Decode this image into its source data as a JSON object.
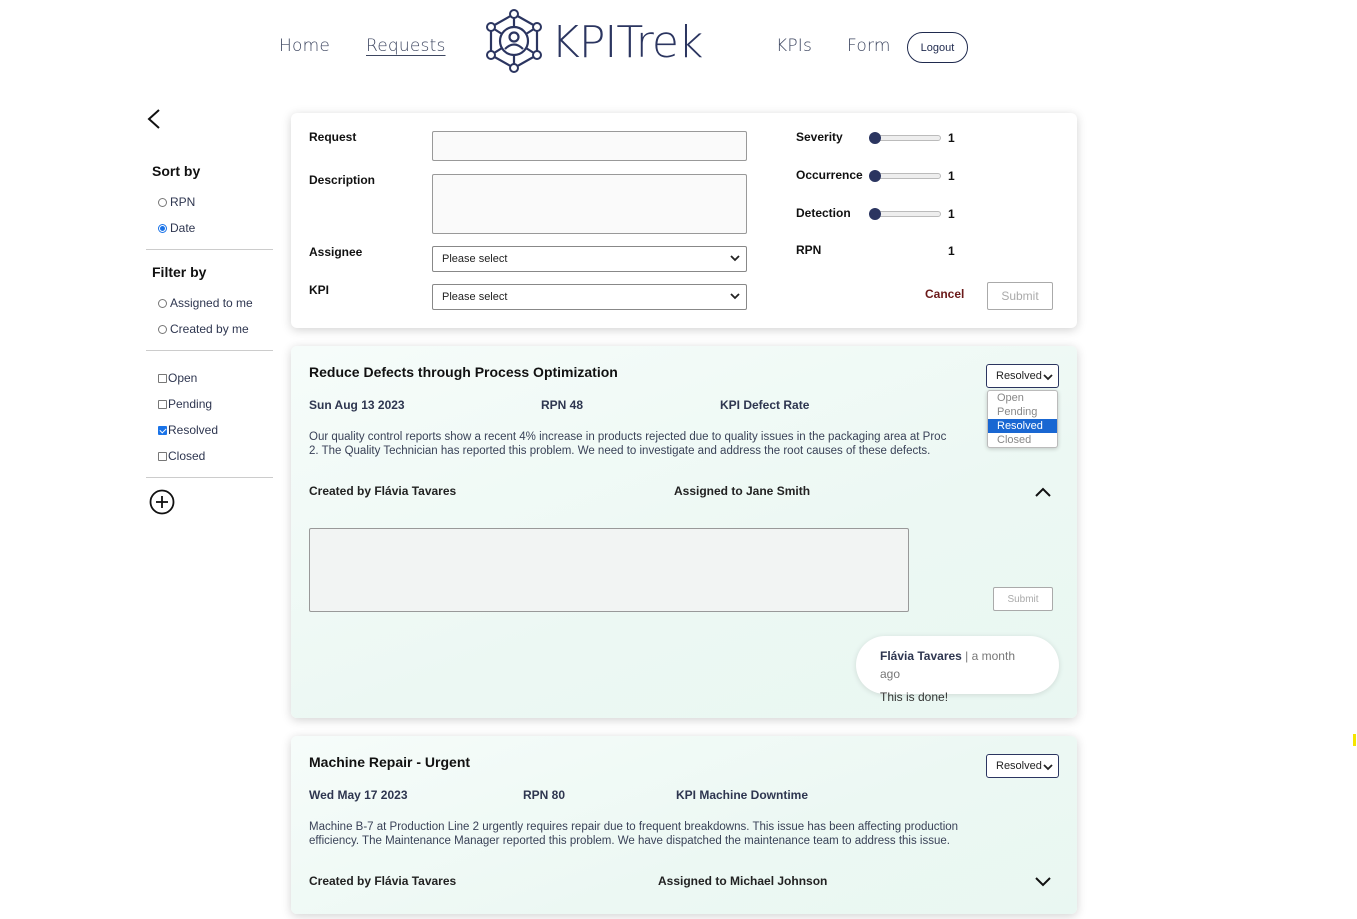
{
  "nav": {
    "home": "Home",
    "requests": "Requests",
    "logo_text": "KPITrek",
    "kpis": "KPIs",
    "form": "Form",
    "logout": "Logout"
  },
  "sidebar": {
    "sort_title": "Sort by",
    "sort_options": [
      {
        "label": "RPN",
        "checked": false
      },
      {
        "label": "Date",
        "checked": true
      }
    ],
    "filter_title": "Filter by",
    "filter_options": [
      {
        "label": "Assigned to me",
        "checked": false
      },
      {
        "label": "Created by me",
        "checked": false
      }
    ],
    "status_options": [
      {
        "label": "Open",
        "checked": false
      },
      {
        "label": "Pending",
        "checked": false
      },
      {
        "label": "Resolved",
        "checked": true
      },
      {
        "label": "Closed",
        "checked": false
      }
    ]
  },
  "new_form": {
    "request_label": "Request",
    "request_value": "",
    "description_label": "Description",
    "description_value": "",
    "assignee_label": "Assignee",
    "assignee_value": "Please select",
    "kpi_label": "KPI",
    "kpi_value": "Please select",
    "severity_label": "Severity",
    "severity_value": "1",
    "occurrence_label": "Occurrence",
    "occurrence_value": "1",
    "detection_label": "Detection",
    "detection_value": "1",
    "rpn_label": "RPN",
    "rpn_value": "1",
    "cancel_label": "Cancel",
    "submit_label": "Submit"
  },
  "requests": [
    {
      "title": "Reduce Defects through Process Optimization",
      "date": "Sun Aug 13 2023",
      "rpn": "RPN 48",
      "kpi": "KPI Defect Rate",
      "description_line1": "Our quality control reports show a recent 4% increase in products rejected due to quality issues in the packaging area at Proc",
      "description_line2": "2. The Quality Technician has reported this problem. We need to investigate and address the root causes of these defects.",
      "created_by": "Created by Flávia Tavares",
      "assigned_to": "Assigned to Jane Smith",
      "status": "Resolved",
      "status_options": [
        "Open",
        "Pending",
        "Resolved",
        "Closed"
      ],
      "comment_value": "",
      "comment_submit": "Submit",
      "comment": {
        "author": "Flávia Tavares",
        "time": " | a month ago",
        "text": "This is done!"
      }
    },
    {
      "title": "Machine Repair - Urgent",
      "date": "Wed May 17 2023",
      "rpn": "RPN 80",
      "kpi": "KPI Machine Downtime",
      "description_line1": "Machine B-7 at Production Line 2 urgently requires repair due to frequent breakdowns. This issue has been affecting production",
      "description_line2": "efficiency. The Maintenance Manager reported this problem. We have dispatched the maintenance team to address this issue.",
      "created_by": "Created by Flávia Tavares",
      "assigned_to": "Assigned to Michael Johnson",
      "status": "Resolved"
    }
  ],
  "colors": {
    "brand": "#2b3560",
    "accent": "#1a73e8",
    "cancel": "#6b1a1a"
  }
}
